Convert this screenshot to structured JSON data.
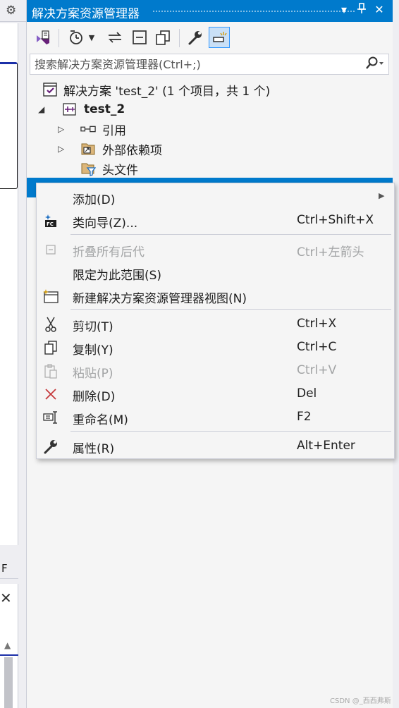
{
  "left_panel": {
    "truncated_letter": "F"
  },
  "pane": {
    "title": "解决方案资源管理器",
    "accent": "#007acc",
    "title_buttons": [
      "dropdown-icon",
      "pin-icon",
      "close-icon"
    ]
  },
  "toolbar": {
    "items": [
      "vs-solution-icon",
      "history-icon",
      "sync-icon",
      "collapse-all-icon",
      "copy-view-icon",
      "properties-icon",
      "preview-selected-icon"
    ]
  },
  "search": {
    "placeholder": "搜索解决方案资源管理器(Ctrl+;)"
  },
  "tree": {
    "solution_label": "解决方案 'test_2' (1 个项目，共 1 个)",
    "project_label": "test_2",
    "items": [
      {
        "label": "引用",
        "icon": "references-icon"
      },
      {
        "label": "外部依赖项",
        "icon": "external-deps-icon"
      },
      {
        "label": "头文件",
        "icon": "filter-folder-icon"
      }
    ]
  },
  "context_menu": {
    "items": [
      {
        "label": "添加(D)",
        "shortcut": "",
        "icon": "",
        "submenu": true,
        "disabled": false
      },
      {
        "label": "类向导(Z)...",
        "shortcut": "Ctrl+Shift+X",
        "icon": "class-wizard-icon",
        "disabled": false
      },
      {
        "label": "折叠所有后代",
        "shortcut": "Ctrl+左箭头",
        "icon": "collapse-icon",
        "disabled": true
      },
      {
        "label": "限定为此范围(S)",
        "shortcut": "",
        "icon": "",
        "disabled": false
      },
      {
        "label": "新建解决方案资源管理器视图(N)",
        "shortcut": "",
        "icon": "new-view-icon",
        "disabled": false
      },
      {
        "label": "剪切(T)",
        "shortcut": "Ctrl+X",
        "icon": "scissors-icon",
        "disabled": false
      },
      {
        "label": "复制(Y)",
        "shortcut": "Ctrl+C",
        "icon": "copy-icon",
        "disabled": false
      },
      {
        "label": "粘贴(P)",
        "shortcut": "Ctrl+V",
        "icon": "paste-icon",
        "disabled": true
      },
      {
        "label": "删除(D)",
        "shortcut": "Del",
        "icon": "delete-icon",
        "disabled": false
      },
      {
        "label": "重命名(M)",
        "shortcut": "F2",
        "icon": "rename-icon",
        "disabled": false
      },
      {
        "label": "属性(R)",
        "shortcut": "Alt+Enter",
        "icon": "wrench-icon",
        "disabled": false
      }
    ]
  },
  "watermark": "CSDN @_西西弗斯"
}
